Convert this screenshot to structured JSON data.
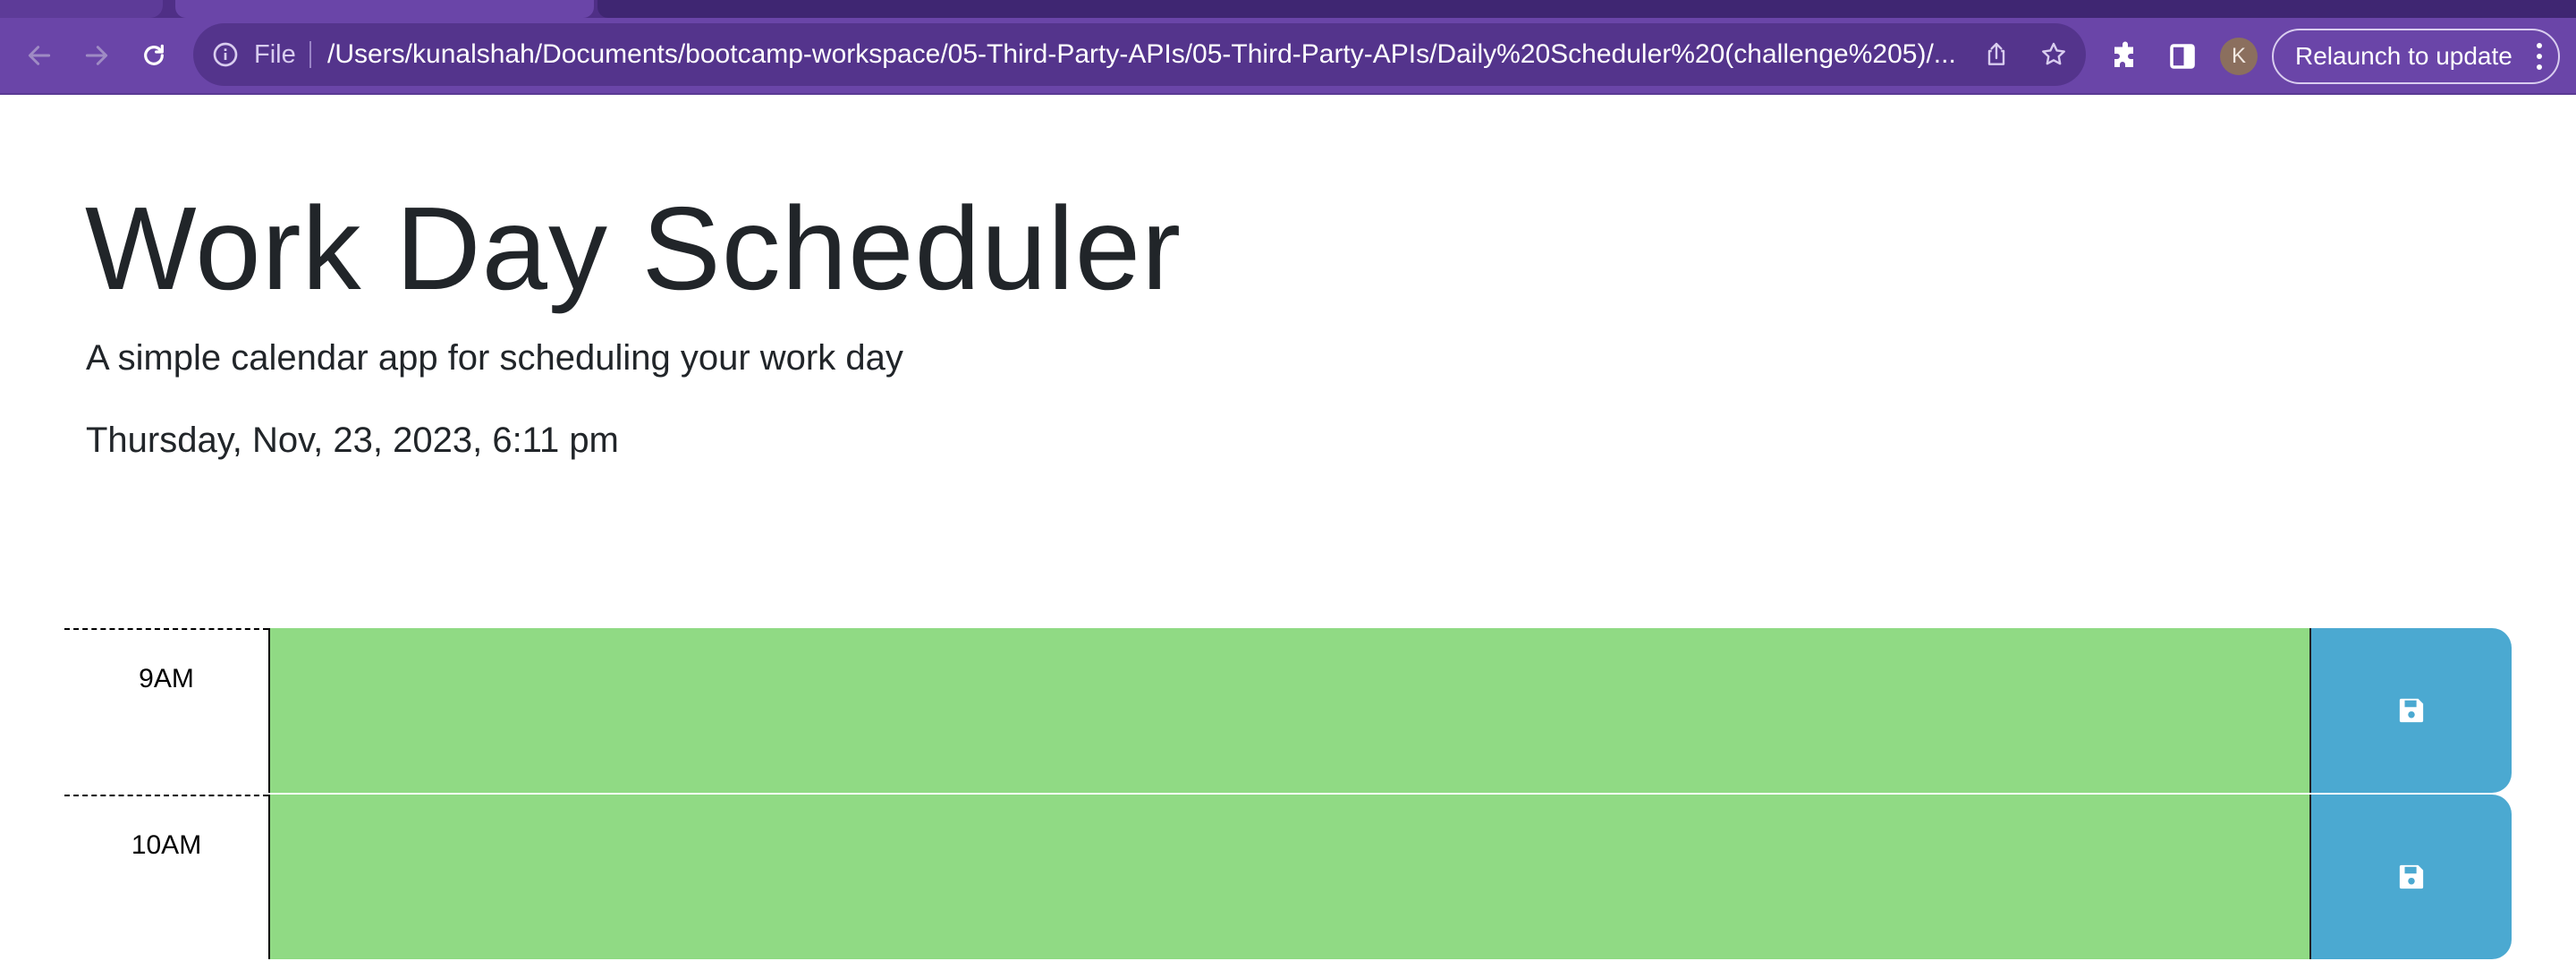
{
  "browser": {
    "url_scheme_label": "File",
    "url": "/Users/kunalshah/Documents/bootcamp-workspace/05-Third-Party-APIs/05-Third-Party-APIs/Daily%20Scheduler%20(challenge%205)/...",
    "profile_initial": "K",
    "relaunch_label": "Relaunch to update",
    "colors": {
      "frame": "#6a45a8",
      "omnibox": "#54348c"
    }
  },
  "header": {
    "title": "Work Day Scheduler",
    "subtitle": "A simple calendar app for scheduling your work day",
    "current_datetime": "Thursday, Nov, 23, 2023, 6:11 pm"
  },
  "schedule": {
    "rows": [
      {
        "hour": "9AM",
        "event_text": "",
        "status": "future",
        "save_icon": "save-icon"
      },
      {
        "hour": "10AM",
        "event_text": "",
        "status": "future",
        "save_icon": "save-icon"
      }
    ],
    "colors": {
      "future": "#90da84",
      "save_button": "#4ba9d1"
    }
  }
}
